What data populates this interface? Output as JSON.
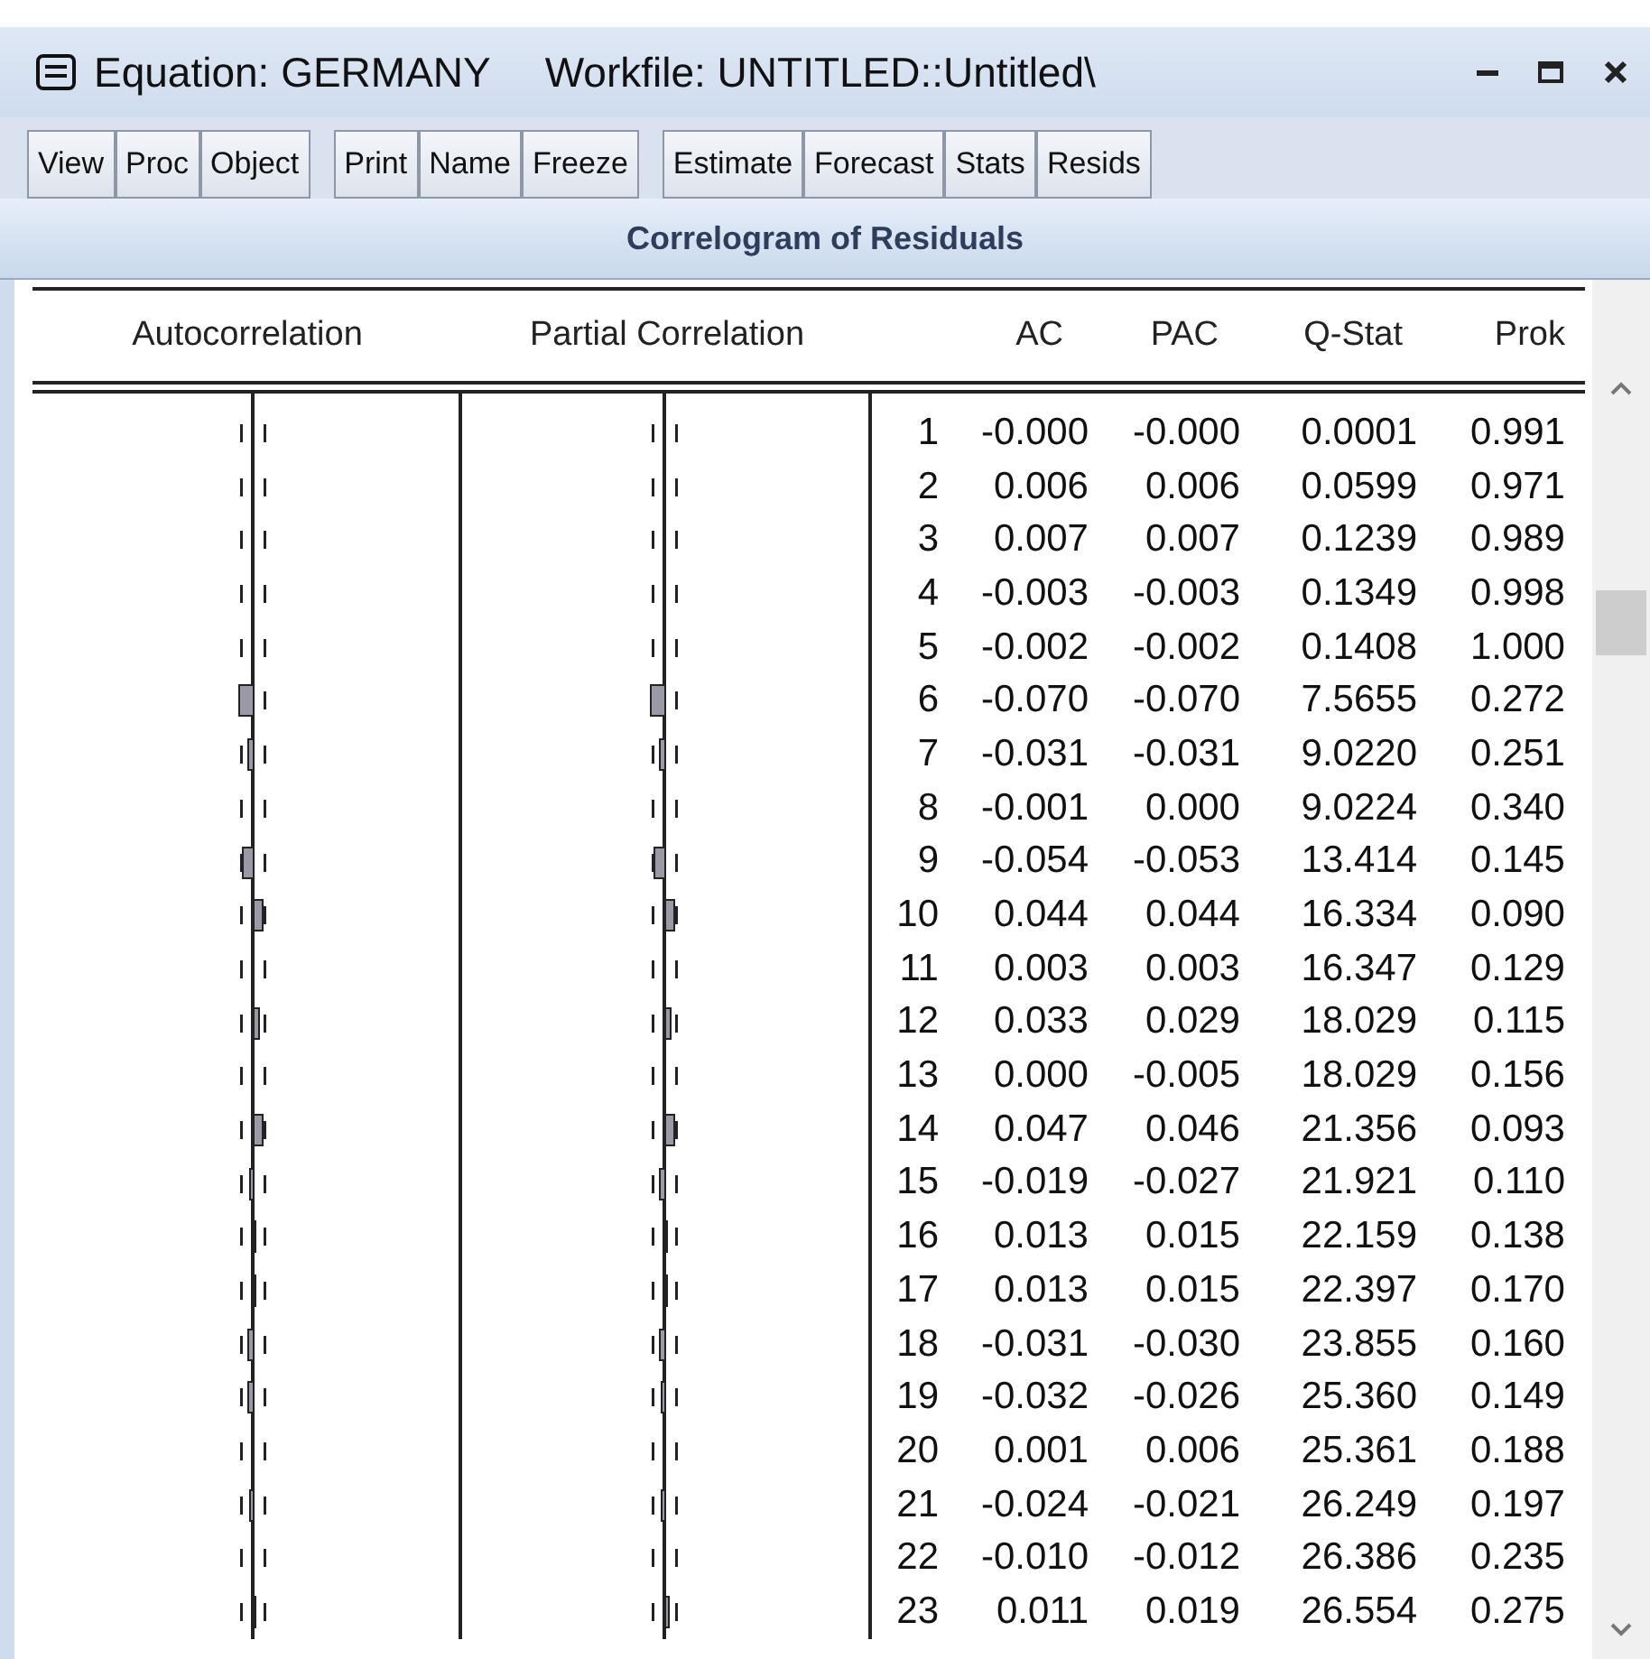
{
  "window": {
    "title": "Equation: GERMANY",
    "subtitle": "Workfile: UNTITLED::Untitled\\"
  },
  "toolbar": {
    "groups": [
      {
        "buttons": [
          "View",
          "Proc",
          "Object"
        ]
      },
      {
        "buttons": [
          "Print",
          "Name",
          "Freeze"
        ]
      },
      {
        "buttons": [
          "Estimate",
          "Forecast",
          "Stats",
          "Resids"
        ]
      }
    ]
  },
  "view_title": "Correlogram of Residuals",
  "table": {
    "columns": [
      "Autocorrelation",
      "Partial Correlation",
      "AC",
      "PAC",
      "Q-Stat",
      "Prok"
    ],
    "rows": [
      {
        "lag": "1",
        "ac": "-0.000",
        "pac": "-0.000",
        "q_stat": "0.0001",
        "prob": "0.991"
      },
      {
        "lag": "2",
        "ac": "0.006",
        "pac": "0.006",
        "q_stat": "0.0599",
        "prob": "0.971"
      },
      {
        "lag": "3",
        "ac": "0.007",
        "pac": "0.007",
        "q_stat": "0.1239",
        "prob": "0.989"
      },
      {
        "lag": "4",
        "ac": "-0.003",
        "pac": "-0.003",
        "q_stat": "0.1349",
        "prob": "0.998"
      },
      {
        "lag": "5",
        "ac": "-0.002",
        "pac": "-0.002",
        "q_stat": "0.1408",
        "prob": "1.000"
      },
      {
        "lag": "6",
        "ac": "-0.070",
        "pac": "-0.070",
        "q_stat": "7.5655",
        "prob": "0.272"
      },
      {
        "lag": "7",
        "ac": "-0.031",
        "pac": "-0.031",
        "q_stat": "9.0220",
        "prob": "0.251"
      },
      {
        "lag": "8",
        "ac": "-0.001",
        "pac": "0.000",
        "q_stat": "9.0224",
        "prob": "0.340"
      },
      {
        "lag": "9",
        "ac": "-0.054",
        "pac": "-0.053",
        "q_stat": "13.414",
        "prob": "0.145"
      },
      {
        "lag": "10",
        "ac": "0.044",
        "pac": "0.044",
        "q_stat": "16.334",
        "prob": "0.090"
      },
      {
        "lag": "11",
        "ac": "0.003",
        "pac": "0.003",
        "q_stat": "16.347",
        "prob": "0.129"
      },
      {
        "lag": "12",
        "ac": "0.033",
        "pac": "0.029",
        "q_stat": "18.029",
        "prob": "0.115"
      },
      {
        "lag": "13",
        "ac": "0.000",
        "pac": "-0.005",
        "q_stat": "18.029",
        "prob": "0.156"
      },
      {
        "lag": "14",
        "ac": "0.047",
        "pac": "0.046",
        "q_stat": "21.356",
        "prob": "0.093"
      },
      {
        "lag": "15",
        "ac": "-0.019",
        "pac": "-0.027",
        "q_stat": "21.921",
        "prob": "0.110"
      },
      {
        "lag": "16",
        "ac": "0.013",
        "pac": "0.015",
        "q_stat": "22.159",
        "prob": "0.138"
      },
      {
        "lag": "17",
        "ac": "0.013",
        "pac": "0.015",
        "q_stat": "22.397",
        "prob": "0.170"
      },
      {
        "lag": "18",
        "ac": "-0.031",
        "pac": "-0.030",
        "q_stat": "23.855",
        "prob": "0.160"
      },
      {
        "lag": "19",
        "ac": "-0.032",
        "pac": "-0.026",
        "q_stat": "25.360",
        "prob": "0.149"
      },
      {
        "lag": "20",
        "ac": "0.001",
        "pac": "0.006",
        "q_stat": "25.361",
        "prob": "0.188"
      },
      {
        "lag": "21",
        "ac": "-0.024",
        "pac": "-0.021",
        "q_stat": "26.249",
        "prob": "0.197"
      },
      {
        "lag": "22",
        "ac": "-0.010",
        "pac": "-0.012",
        "q_stat": "26.386",
        "prob": "0.235"
      },
      {
        "lag": "23",
        "ac": "0.011",
        "pac": "0.019",
        "q_stat": "26.554",
        "prob": "0.275"
      }
    ]
  }
}
